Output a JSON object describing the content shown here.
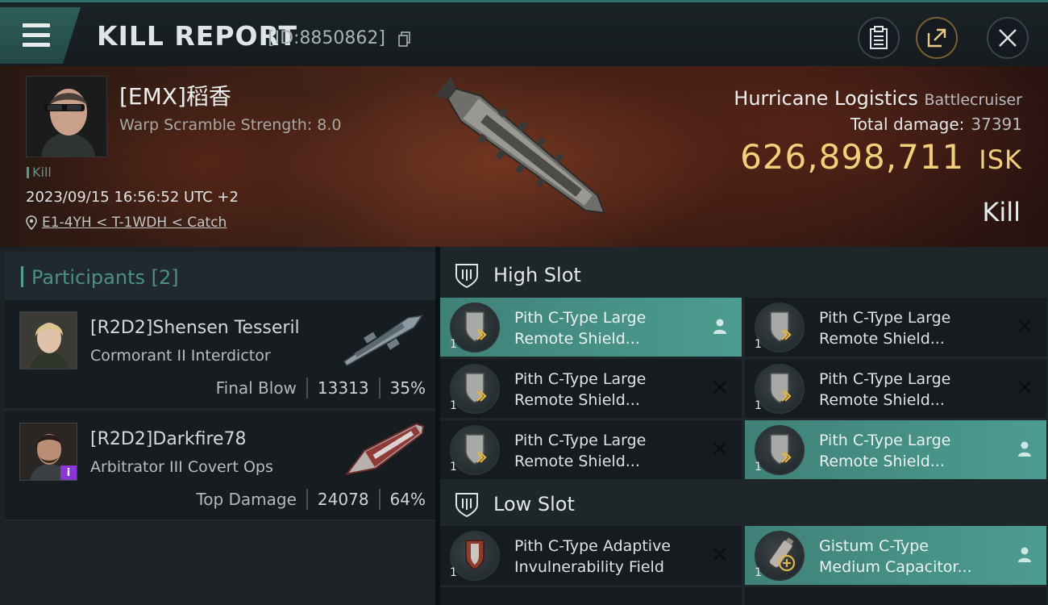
{
  "header": {
    "title": "KILL REPORT",
    "report_id": "[ID:8850862]"
  },
  "victim": {
    "name": "[EMX]稻香",
    "scramble": "Warp Scramble Strength: 8.0",
    "kill_tag": "Kill",
    "timestamp": "2023/09/15 16:56:52 UTC +2",
    "location": "E1-4YH < T-1WDH < Catch",
    "ship_name": "Hurricane Logistics",
    "ship_class": "Battlecruiser",
    "total_damage_label": "Total damage:",
    "total_damage": "37391",
    "isk_value": "626,898,711",
    "isk_unit": "ISK",
    "result": "Kill"
  },
  "participants": {
    "title": "Participants",
    "count": "[2]",
    "items": [
      {
        "name": "[R2D2]Shensen Tesseril",
        "ship": "Cormorant II Interdictor",
        "role": "Final Blow",
        "damage": "13313",
        "percent": "35%"
      },
      {
        "name": "[R2D2]Darkfire78",
        "ship": "Arbitrator III Covert Ops",
        "role": "Top Damage",
        "damage": "24078",
        "percent": "64%"
      }
    ]
  },
  "fitting": {
    "high_slot": {
      "label": "High Slot",
      "modules": [
        {
          "line1": "Pith C-Type Large",
          "line2": "Remote Shield...",
          "qty": "1",
          "state": "destroyed-highlight",
          "action_icon": "person-icon"
        },
        {
          "line1": "Pith C-Type Large",
          "line2": "Remote Shield...",
          "qty": "1",
          "state": "destroyed",
          "action_icon": "x-icon"
        },
        {
          "line1": "Pith C-Type Large",
          "line2": "Remote Shield...",
          "qty": "1",
          "state": "destroyed",
          "action_icon": "x-icon"
        },
        {
          "line1": "Pith C-Type Large",
          "line2": "Remote Shield...",
          "qty": "1",
          "state": "destroyed",
          "action_icon": "x-icon"
        },
        {
          "line1": "Pith C-Type Large",
          "line2": "Remote Shield...",
          "qty": "1",
          "state": "destroyed",
          "action_icon": "x-icon"
        },
        {
          "line1": "Pith C-Type Large",
          "line2": "Remote Shield...",
          "qty": "1",
          "state": "dropped-highlight",
          "action_icon": "person-icon"
        }
      ]
    },
    "low_slot": {
      "label": "Low Slot",
      "modules": [
        {
          "line1": "Pith C-Type Adaptive",
          "line2": "Invulnerability Field",
          "qty": "1",
          "state": "destroyed",
          "action_icon": "x-icon"
        },
        {
          "line1": "Gistum C-Type",
          "line2": "Medium Capacitor...",
          "qty": "1",
          "state": "dropped-highlight",
          "action_icon": "person-icon"
        }
      ]
    }
  },
  "colors": {
    "accent_teal": "#4d9c91",
    "isk_gold": "#f2cf7a",
    "background": "#0d1216"
  }
}
